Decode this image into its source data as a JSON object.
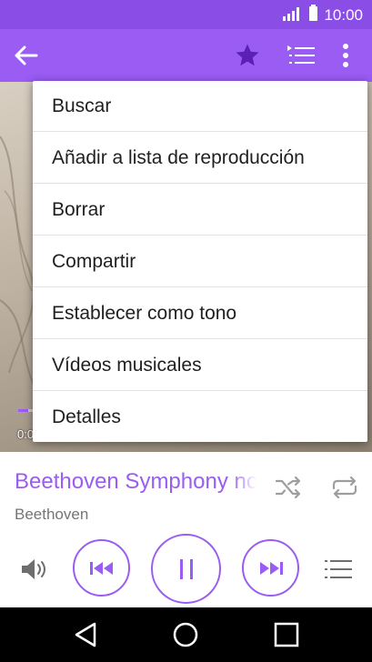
{
  "status_bar": {
    "time": "10:00"
  },
  "overflow_menu": {
    "items": [
      {
        "label": "Buscar"
      },
      {
        "label": "Añadir a lista de reproducción"
      },
      {
        "label": "Borrar"
      },
      {
        "label": "Compartir"
      },
      {
        "label": "Establecer como tono"
      },
      {
        "label": "Vídeos musicales"
      },
      {
        "label": "Detalles"
      }
    ]
  },
  "player": {
    "elapsed_time": "0:0",
    "song_title": "Beethoven Symphony no",
    "artist": "Beethoven",
    "progress_fraction": 0.03
  },
  "colors": {
    "accent": "#9a5cf2",
    "status_bar": "#8a4ee6",
    "nav_bar": "#000000"
  },
  "icons": {
    "back": "arrow-left-icon",
    "favorite": "star-icon",
    "queue": "queue-list-icon",
    "more": "more-vertical-icon",
    "shuffle": "shuffle-icon",
    "repeat": "repeat-icon",
    "volume": "volume-icon",
    "previous": "skip-previous-icon",
    "pause": "pause-icon",
    "next": "skip-next-icon",
    "playlist": "playlist-icon"
  }
}
